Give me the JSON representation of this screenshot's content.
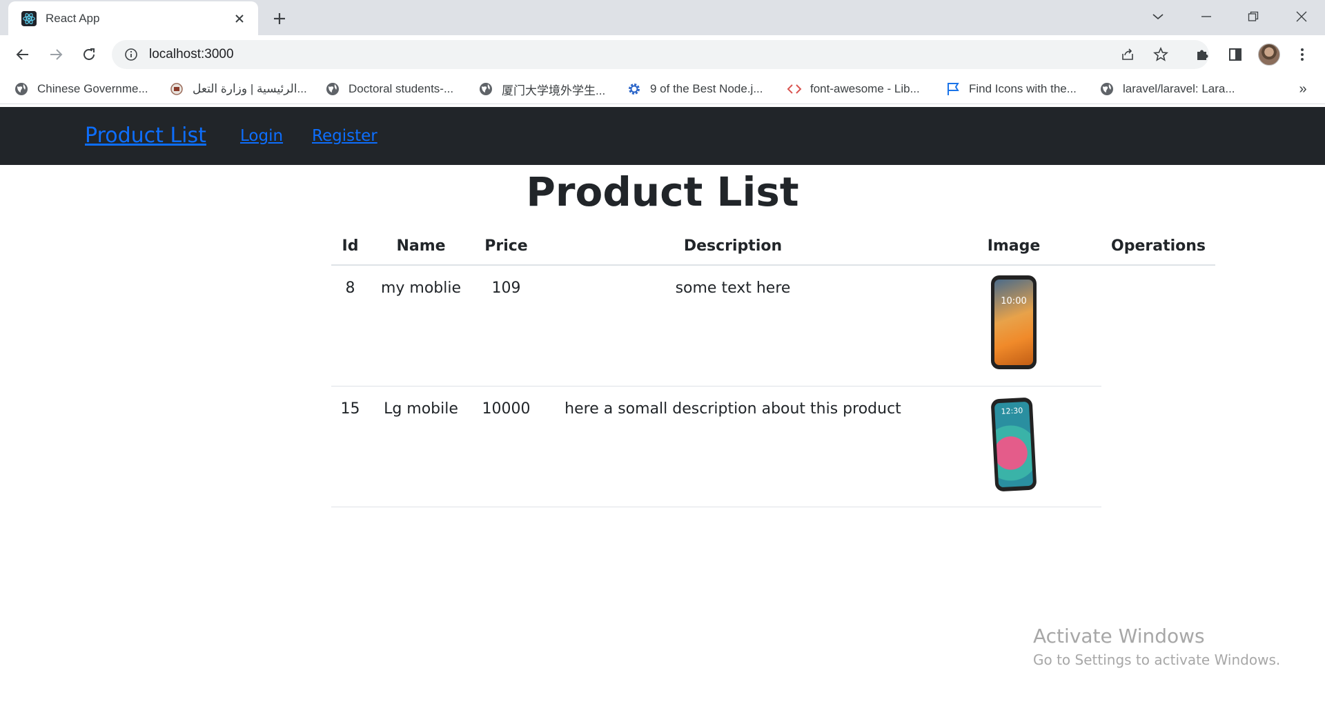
{
  "browser": {
    "tab_title": "React App",
    "url": "localhost:3000",
    "bookmarks": [
      {
        "label": "Chinese Governme...",
        "icon": "globe-icon"
      },
      {
        "label": "الرئيسية | وزارة التعل...",
        "icon": "ministry-logo-icon"
      },
      {
        "label": "Doctoral students-...",
        "icon": "globe-icon"
      },
      {
        "label": "厦门大学境外学生...",
        "icon": "globe-icon"
      },
      {
        "label": "9 of the Best Node.j...",
        "icon": "gear-icon"
      },
      {
        "label": "font-awesome - Lib...",
        "icon": "code-icon"
      },
      {
        "label": "Find Icons with the...",
        "icon": "flag-icon"
      },
      {
        "label": "laravel/laravel: Lara...",
        "icon": "globe-icon"
      }
    ],
    "bookmarks_more": "»"
  },
  "app_nav": {
    "brand": "Product List",
    "login": "Login",
    "register": "Register"
  },
  "page": {
    "title": "Product List"
  },
  "table": {
    "headers": {
      "id": "Id",
      "name": "Name",
      "price": "Price",
      "description": "Description",
      "image": "Image",
      "operations": "Operations"
    },
    "rows": [
      {
        "id": "8",
        "name": "my moblie",
        "price": "109",
        "description": "some text here",
        "image_time": "10:00"
      },
      {
        "id": "15",
        "name": "Lg mobile",
        "price": "10000",
        "description": "here a somall description about this product",
        "image_time": "12:30"
      }
    ]
  },
  "watermark": {
    "line1": "Activate Windows",
    "line2": "Go to Settings to activate Windows."
  }
}
